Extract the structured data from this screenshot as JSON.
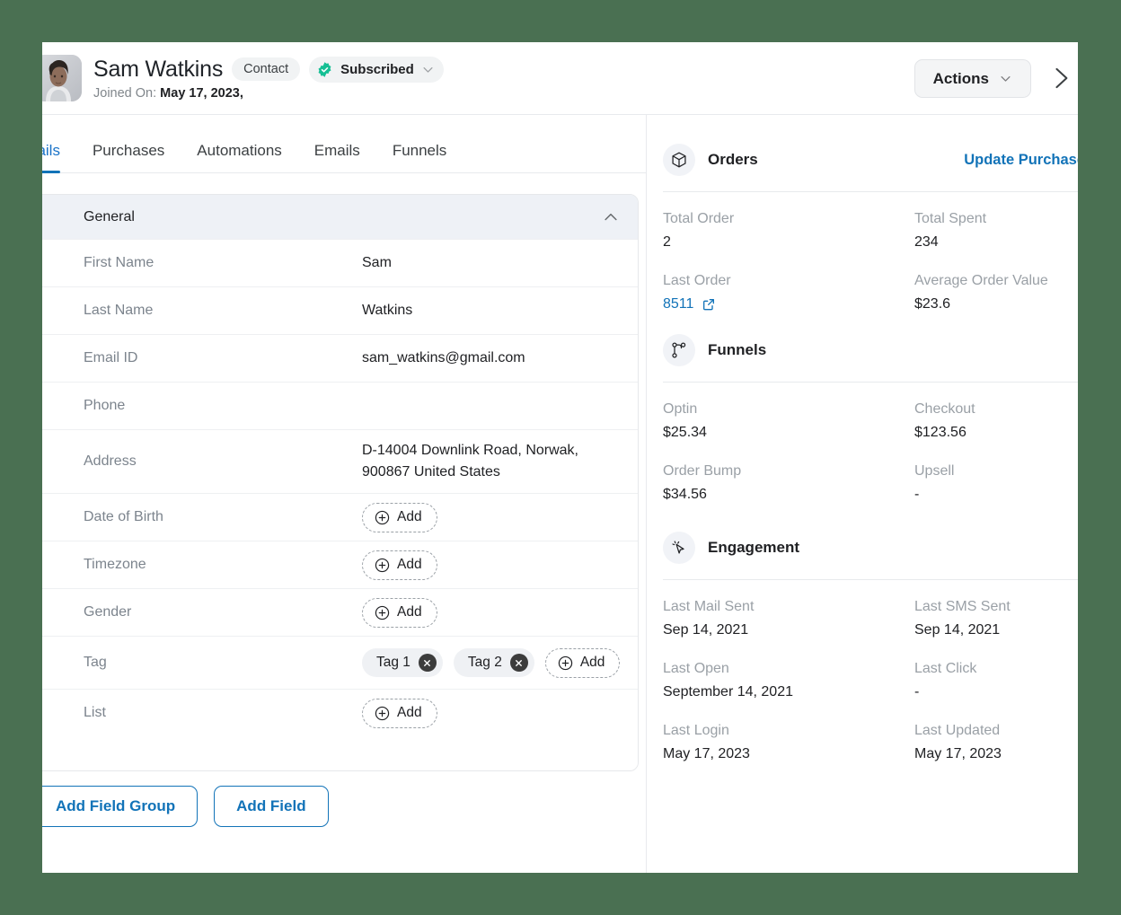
{
  "header": {
    "person_name": "Sam Watkins",
    "contact_pill": "Contact",
    "status_pill": "Subscribed",
    "joined_label": "Joined On:",
    "joined_value": "May 17, 2023,",
    "actions_label": "Actions"
  },
  "tabs": [
    {
      "label": "Details",
      "active": true
    },
    {
      "label": "Purchases",
      "active": false
    },
    {
      "label": "Automations",
      "active": false
    },
    {
      "label": "Emails",
      "active": false
    },
    {
      "label": "Funnels",
      "active": false
    }
  ],
  "field_group": {
    "title": "General",
    "add_label": "Add",
    "rows": [
      {
        "label": "First Name",
        "value": "Sam",
        "type": "text"
      },
      {
        "label": "Last Name",
        "value": "Watkins",
        "type": "text"
      },
      {
        "label": "Email ID",
        "value": "sam_watkins@gmail.com",
        "type": "text"
      },
      {
        "label": "Phone",
        "value": "",
        "type": "text"
      },
      {
        "label": "Address",
        "value": "D-14004  Downlink Road, Norwak, 900867 United States",
        "type": "text"
      },
      {
        "label": "Date of Birth",
        "value": "",
        "type": "add"
      },
      {
        "label": "Timezone",
        "value": "",
        "type": "add"
      },
      {
        "label": "Gender",
        "value": "",
        "type": "add"
      },
      {
        "label": "Tag",
        "value": "",
        "type": "tags",
        "tags": [
          "Tag 1",
          "Tag 2"
        ]
      },
      {
        "label": "List",
        "value": "",
        "type": "add"
      }
    ]
  },
  "footer_buttons": {
    "add_field_group": "Add Field Group",
    "add_field": "Add Field"
  },
  "sections": [
    {
      "id": "orders",
      "title": "Orders",
      "icon": "box-icon",
      "link": "Update Purchase",
      "items": [
        {
          "label": "Total Order",
          "value": "2",
          "link": false
        },
        {
          "label": "Total Spent",
          "value": "234",
          "link": false
        },
        {
          "label": "Last Order",
          "value": "8511",
          "link": true
        },
        {
          "label": "Average Order Value",
          "value": "$23.6",
          "link": false
        }
      ]
    },
    {
      "id": "funnels",
      "title": "Funnels",
      "icon": "funnel-node-icon",
      "link": "",
      "items": [
        {
          "label": "Optin",
          "value": "$25.34",
          "link": false
        },
        {
          "label": "Checkout",
          "value": "$123.56",
          "link": false
        },
        {
          "label": "Order Bump",
          "value": "$34.56",
          "link": false
        },
        {
          "label": "Upsell",
          "value": "-",
          "link": false
        }
      ]
    },
    {
      "id": "engagement",
      "title": "Engagement",
      "icon": "cursor-click-icon",
      "link": "",
      "items": [
        {
          "label": "Last Mail Sent",
          "value": "Sep 14, 2021",
          "link": false
        },
        {
          "label": "Last SMS Sent",
          "value": "Sep 14, 2021",
          "link": false
        },
        {
          "label": "Last Open",
          "value": "September 14, 2021",
          "link": false
        },
        {
          "label": "Last Click",
          "value": "-",
          "link": false
        },
        {
          "label": "Last Login",
          "value": "May 17, 2023",
          "link": false
        },
        {
          "label": "Last Updated",
          "value": "May 17, 2023",
          "link": false
        }
      ]
    }
  ],
  "colors": {
    "page_background": "#4a7052",
    "accent_blue": "#1273b8",
    "verified_green": "#1fbf92",
    "group_header_bg": "#eef1f6"
  }
}
